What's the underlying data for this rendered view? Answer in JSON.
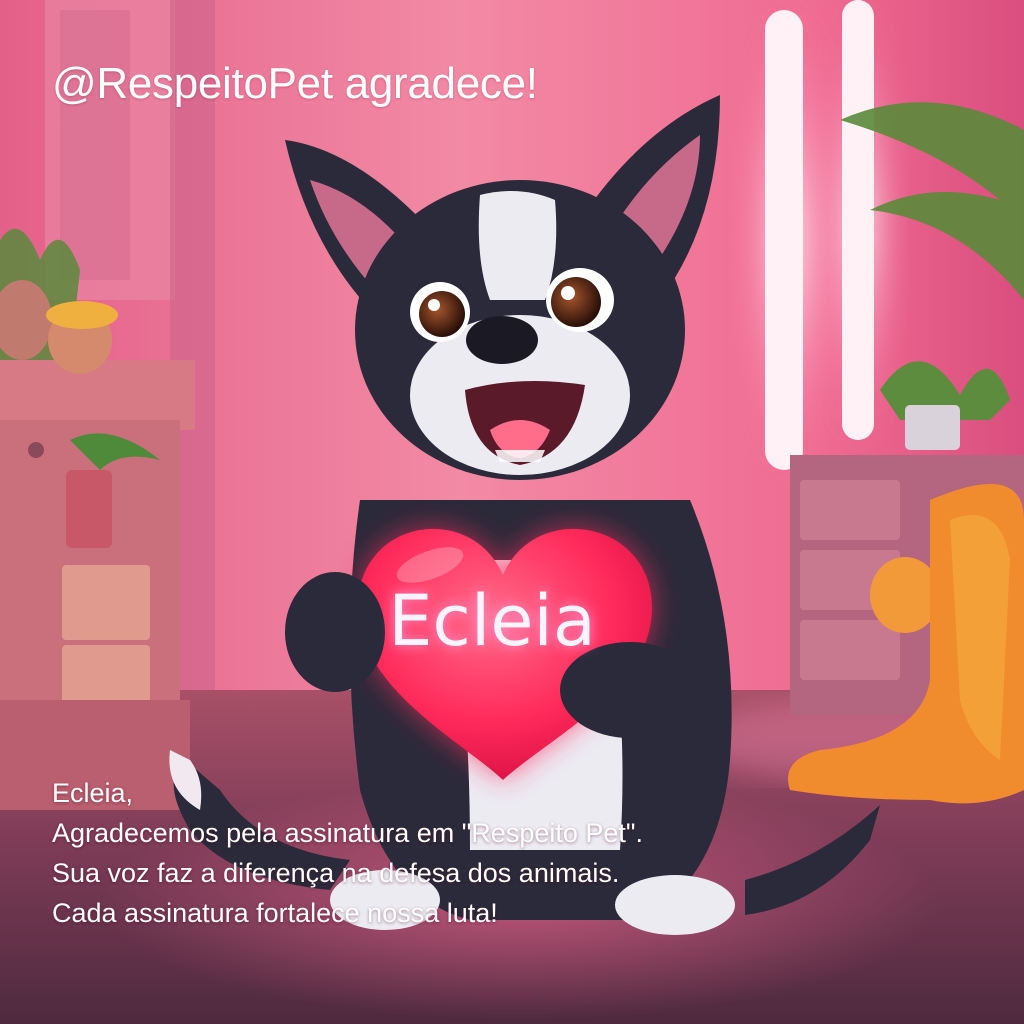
{
  "header": {
    "title": "@RespeitoPet agradece!"
  },
  "heart": {
    "name": "Ecleia"
  },
  "message": {
    "lines": [
      "Ecleia,",
      "Agradecemos pela assinatura em \"Respeito Pet\".",
      "Sua voz faz a diferença na defesa dos animais.",
      "Cada assinatura fortalece nossa luta!"
    ]
  },
  "colors": {
    "wall": "#f07a96",
    "floor": "#6b3648",
    "neon": "#ffe9f2",
    "heart": "#ff2a5a",
    "fur_dark": "#2b2a3a",
    "fur_light": "#ecebf2",
    "text": "#ffffff"
  }
}
